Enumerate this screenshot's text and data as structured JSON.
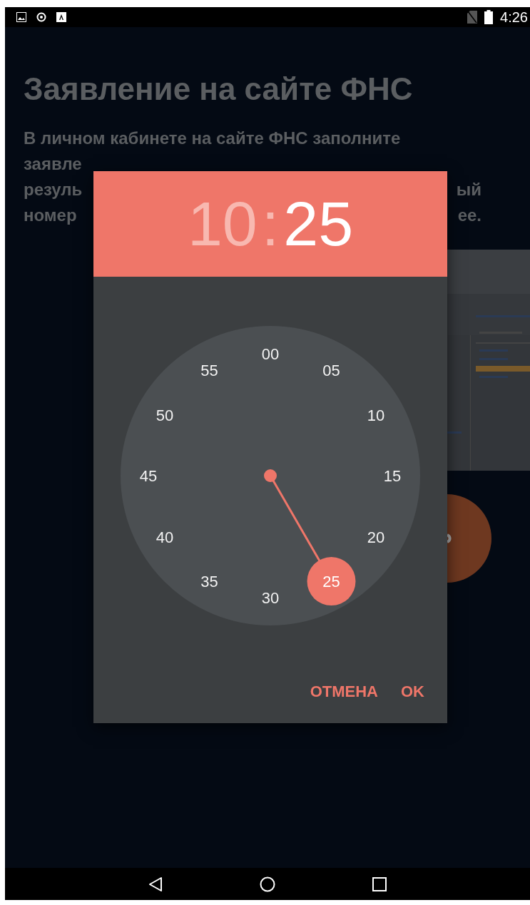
{
  "status_bar": {
    "time": "4:26"
  },
  "background": {
    "title": "Заявление на сайте ФНС",
    "paragraph_lines": [
      [
        "В личном кабинете на сайте ФНС заполните"
      ],
      [
        "заявле"
      ],
      [
        "резуль",
        "ый"
      ],
      [
        "номер",
        "ее."
      ]
    ],
    "picture": {
      "kind": "picture"
    }
  },
  "time_picker": {
    "hour": {
      "text": "10",
      "selected": false
    },
    "separator": ":",
    "minute": {
      "text": "25",
      "selected": true
    },
    "dial": [
      {
        "label": "00",
        "selected": false
      },
      {
        "label": "05",
        "selected": false
      },
      {
        "label": "10",
        "selected": false
      },
      {
        "label": "15",
        "selected": false
      },
      {
        "label": "20",
        "selected": false
      },
      {
        "label": "25",
        "selected": true
      },
      {
        "label": "30",
        "selected": false
      },
      {
        "label": "35",
        "selected": false
      },
      {
        "label": "40",
        "selected": false
      },
      {
        "label": "45",
        "selected": false
      },
      {
        "label": "50",
        "selected": false
      },
      {
        "label": "55",
        "selected": false
      }
    ],
    "buttons": [
      "ОТМЕНА",
      "OK"
    ]
  }
}
